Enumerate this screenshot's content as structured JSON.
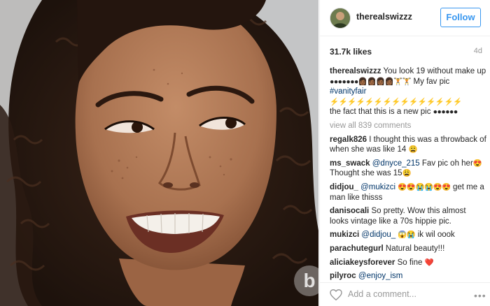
{
  "colors": {
    "accent": "#3897f0",
    "link": "#003569",
    "muted": "#999999",
    "heart": "#ed4956"
  },
  "header": {
    "username": "therealswizzz",
    "follow_label": "Follow"
  },
  "stats": {
    "likes": "31.7k likes",
    "time_ago": "4d"
  },
  "caption": {
    "username": "therealswizzz",
    "text": "You look 19 without make up",
    "emojis_1": "●●●●●●●👩🏾👩🏾👩🏾👩🏾🏋🏋",
    "text_2": "My fav pic",
    "hashtag": "#vanityfair",
    "emojis_2": "⚡⚡⚡⚡⚡⚡⚡⚡⚡⚡⚡⚡⚡⚡⚡",
    "text_3": "the fact that this is a new pic",
    "emojis_3": "●●●●●●"
  },
  "view_all": "view all 839 comments",
  "comments": [
    {
      "username": "regalk826",
      "text": "I thought this was a throwback of when she was like 14",
      "emoji": "😩"
    },
    {
      "username": "ms_swack",
      "mention": "@dnyce_215",
      "text": "Fav pic oh her",
      "text2": "Thought she was 15",
      "emoji": "😍",
      "emoji2": "😩"
    },
    {
      "username": "didjou_",
      "mention": "@mukizci",
      "emoji": "😍😍😭😭😍😍",
      "text": "get me a man like thisss"
    },
    {
      "username": "danisocali",
      "text": "So pretty. Wow this almost looks vintage like a 70s hippie pic."
    },
    {
      "username": "mukizci",
      "mention": "@didjou_",
      "emoji": "😱😭",
      "text": "ik wil oook"
    },
    {
      "username": "parachutegurl",
      "text": "Natural beauty!!!"
    },
    {
      "username": "aliciakeysforever",
      "text": "So fine",
      "emoji": "❤️"
    },
    {
      "username": "pilyroc",
      "mention": "@enjoy_ism"
    }
  ],
  "add_comment": {
    "placeholder": "Add a comment...",
    "more_icon": "more-dots-icon",
    "heart_icon": "heart-icon"
  },
  "photo": {
    "watermark_letter": "b"
  }
}
